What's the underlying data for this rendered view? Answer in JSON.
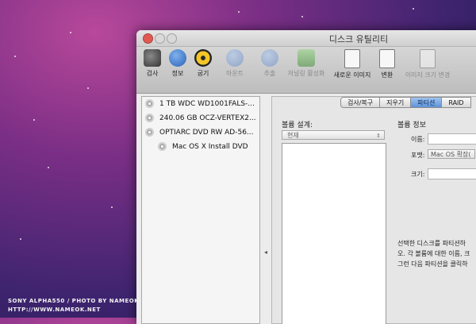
{
  "window": {
    "title": "디스크 유틸리티"
  },
  "toolbar": {
    "items": [
      {
        "label": "검사",
        "icon": "microscope-icon"
      },
      {
        "label": "정보",
        "icon": "info-icon"
      },
      {
        "label": "굽기",
        "icon": "burn-icon"
      },
      {
        "label": "마운트",
        "icon": "mount-icon"
      },
      {
        "label": "추출",
        "icon": "eject-icon"
      },
      {
        "label": "저널링 활성화",
        "icon": "log-icon"
      },
      {
        "label": "새로운 이미지",
        "icon": "new-image-icon"
      },
      {
        "label": "변환",
        "icon": "convert-icon"
      },
      {
        "label": "이미지 크기 변경",
        "icon": "resize-image-icon"
      }
    ]
  },
  "sidebar": {
    "disks": [
      {
        "label": "1 TB WDC WD1001FALS-..."
      },
      {
        "label": "240.06 GB OCZ-VERTEX2..."
      },
      {
        "label": "OPTIARC DVD RW AD-56..."
      },
      {
        "label": "Mac OS X Install DVD"
      }
    ]
  },
  "tabs": [
    "검사/복구",
    "지우기",
    "파티션",
    "RAID"
  ],
  "partition": {
    "volume_scheme_label": "볼륨 설계:",
    "volume_scheme_value": "현재",
    "volume_info_label": "볼륨 정보",
    "name_label": "이름:",
    "format_label": "포맷:",
    "format_value": "Mac OS 확장(",
    "size_label": "크기:",
    "description_lines": [
      "선택한 디스크를 파티션하",
      "오. 각 볼륨에 대한 이름, 크",
      "그런 다음 파티션을 클릭하"
    ]
  },
  "caption": {
    "line1": "SONY ALPHA550 / PHOTO BY NAMEOK",
    "line2": "HTTP://WWW.NAMEOK.NET"
  }
}
